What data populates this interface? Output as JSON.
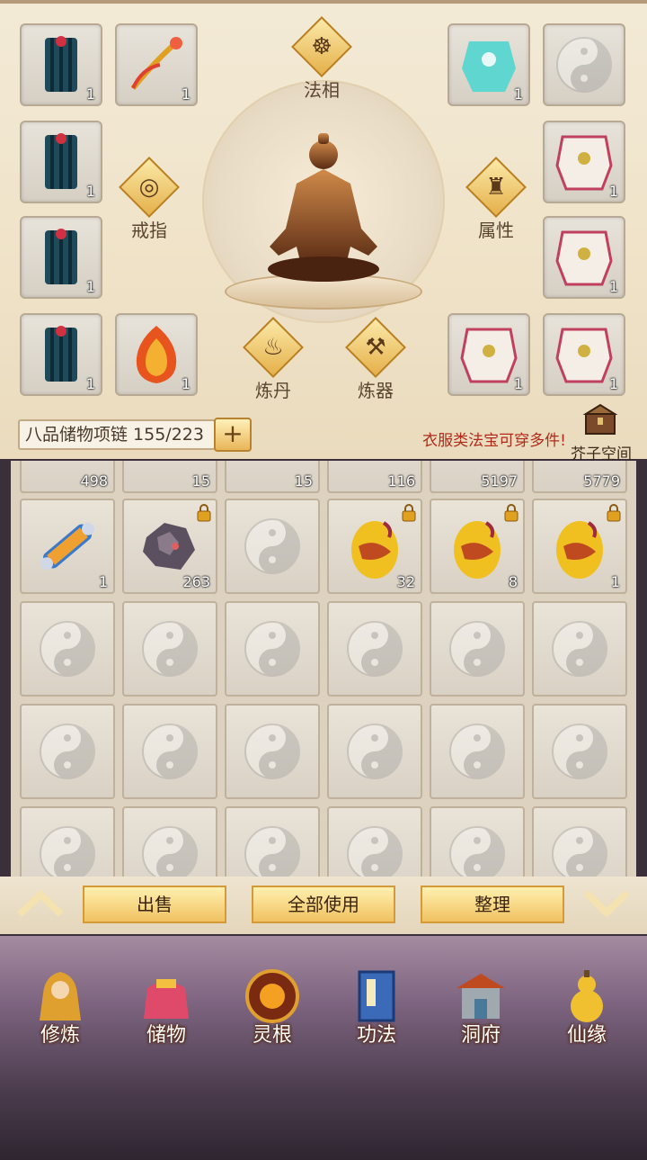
{
  "equipment": {
    "left_slots": [
      {
        "icon": "robe-skirt-icon",
        "count": "1"
      },
      {
        "icon": "phoenix-bow-icon",
        "count": "1"
      },
      {
        "icon": "robe-skirt-icon",
        "count": "1"
      },
      {
        "icon": "robe-skirt-icon",
        "count": "1"
      },
      {
        "icon": "robe-skirt-icon",
        "count": "1"
      },
      {
        "icon": "flame-armor-icon",
        "count": "1"
      }
    ],
    "right_slots": [
      {
        "icon": "jade-robe-icon",
        "count": "1"
      },
      {
        "icon": "empty-slot-icon",
        "count": ""
      },
      {
        "icon": "white-robe-icon",
        "count": "1"
      },
      {
        "icon": "white-robe-icon",
        "count": "1"
      },
      {
        "icon": "white-robe-icon",
        "count": "1"
      },
      {
        "icon": "white-robe-icon",
        "count": "1"
      }
    ],
    "buttons": {
      "faxiang": "法相",
      "ring": "戒指",
      "attributes": "属性",
      "alchemy": "炼丹",
      "forge": "炼器"
    }
  },
  "storage": {
    "capacity_label": "八品储物项链 155/223",
    "plus_label": "+",
    "hint": "衣服类法宝可穿多件!",
    "jiezi_label": "芥子空间",
    "partial_row_counts": [
      "498",
      "15",
      "15",
      "116",
      "5197",
      "5779"
    ],
    "row1": [
      {
        "icon": "scroll-icon",
        "count": "1",
        "locked": false
      },
      {
        "icon": "ore-icon",
        "count": "263",
        "locked": true
      },
      {
        "icon": "empty-slot-icon",
        "count": "",
        "locked": false
      },
      {
        "icon": "dragon-egg-icon",
        "count": "32",
        "locked": true
      },
      {
        "icon": "dragon-egg-icon",
        "count": "8",
        "locked": true
      },
      {
        "icon": "dragon-egg-icon",
        "count": "1",
        "locked": true
      }
    ]
  },
  "actions": {
    "sell": "出售",
    "use_all": "全部使用",
    "organize": "整理"
  },
  "nav": [
    {
      "label": "修炼",
      "icon": "cultivate-icon"
    },
    {
      "label": "储物",
      "icon": "storage-bag-icon"
    },
    {
      "label": "灵根",
      "icon": "spirit-root-icon"
    },
    {
      "label": "功法",
      "icon": "technique-book-icon"
    },
    {
      "label": "洞府",
      "icon": "cave-mansion-icon"
    },
    {
      "label": "仙缘",
      "icon": "fate-gourd-icon"
    }
  ]
}
